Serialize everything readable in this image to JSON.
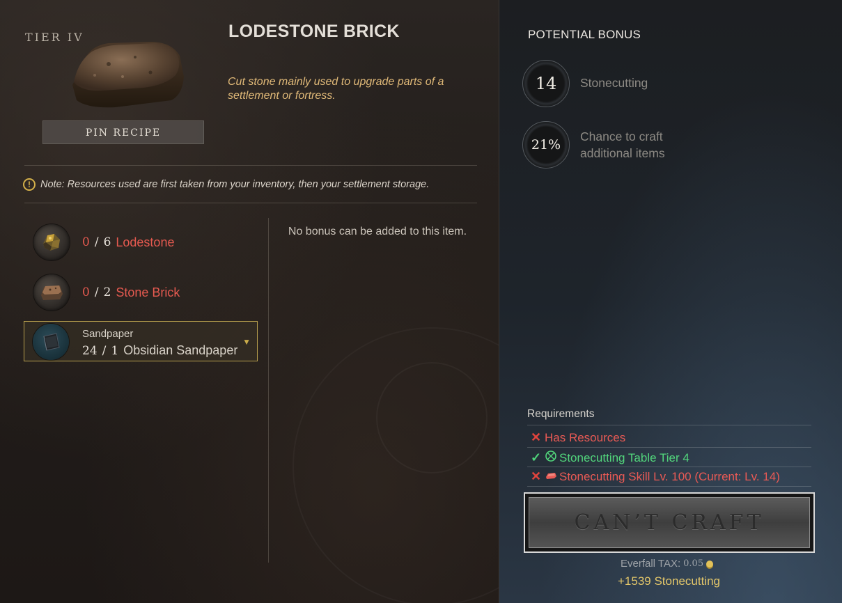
{
  "item": {
    "tier": "TIER IV",
    "name": "LODESTONE BRICK",
    "description": "Cut stone mainly used to upgrade parts of a settlement or fortress.",
    "pin_label": "PIN RECIPE"
  },
  "note": "Note: Resources used are first taken from your inventory, then your settlement storage.",
  "resources": [
    {
      "have": "0",
      "sep": "/",
      "need": "6",
      "name": "Lodestone",
      "icon": "lodestone-icon"
    },
    {
      "have": "0",
      "sep": "/",
      "need": "2",
      "name": "Stone Brick",
      "icon": "stone-brick-icon"
    }
  ],
  "sandpaper": {
    "label": "Sandpaper",
    "have": "24",
    "sep": "/",
    "need": "1",
    "name": "Obsidian Sandpaper",
    "icon": "obsidian-sandpaper-icon"
  },
  "no_bonus_text": "No bonus can be added to this item.",
  "potential_bonus": {
    "title": "POTENTIAL BONUS",
    "items": [
      {
        "value": "14",
        "label": "Stonecutting"
      },
      {
        "value": "21%",
        "label": "Chance to craft additional items"
      }
    ]
  },
  "requirements": {
    "title": "Requirements",
    "items": [
      {
        "met": false,
        "text": "Has Resources",
        "icon": "x-icon"
      },
      {
        "met": true,
        "text": "Stonecutting Table Tier 4",
        "icon": "stonecutting-table-icon"
      },
      {
        "met": false,
        "text": "Stonecutting Skill Lv. 100 (Current: Lv. 14)",
        "icon": "skill-icon"
      }
    ]
  },
  "craft_button": "CAN’T CRAFT",
  "tax": {
    "label": "Everfall TAX:",
    "value": "0.05",
    "icon": "coin-icon"
  },
  "xp_gain": "+1539 Stonecutting",
  "colors": {
    "fail": "#ea5a55",
    "ok": "#52d67c",
    "accent_gold": "#e0b978"
  }
}
